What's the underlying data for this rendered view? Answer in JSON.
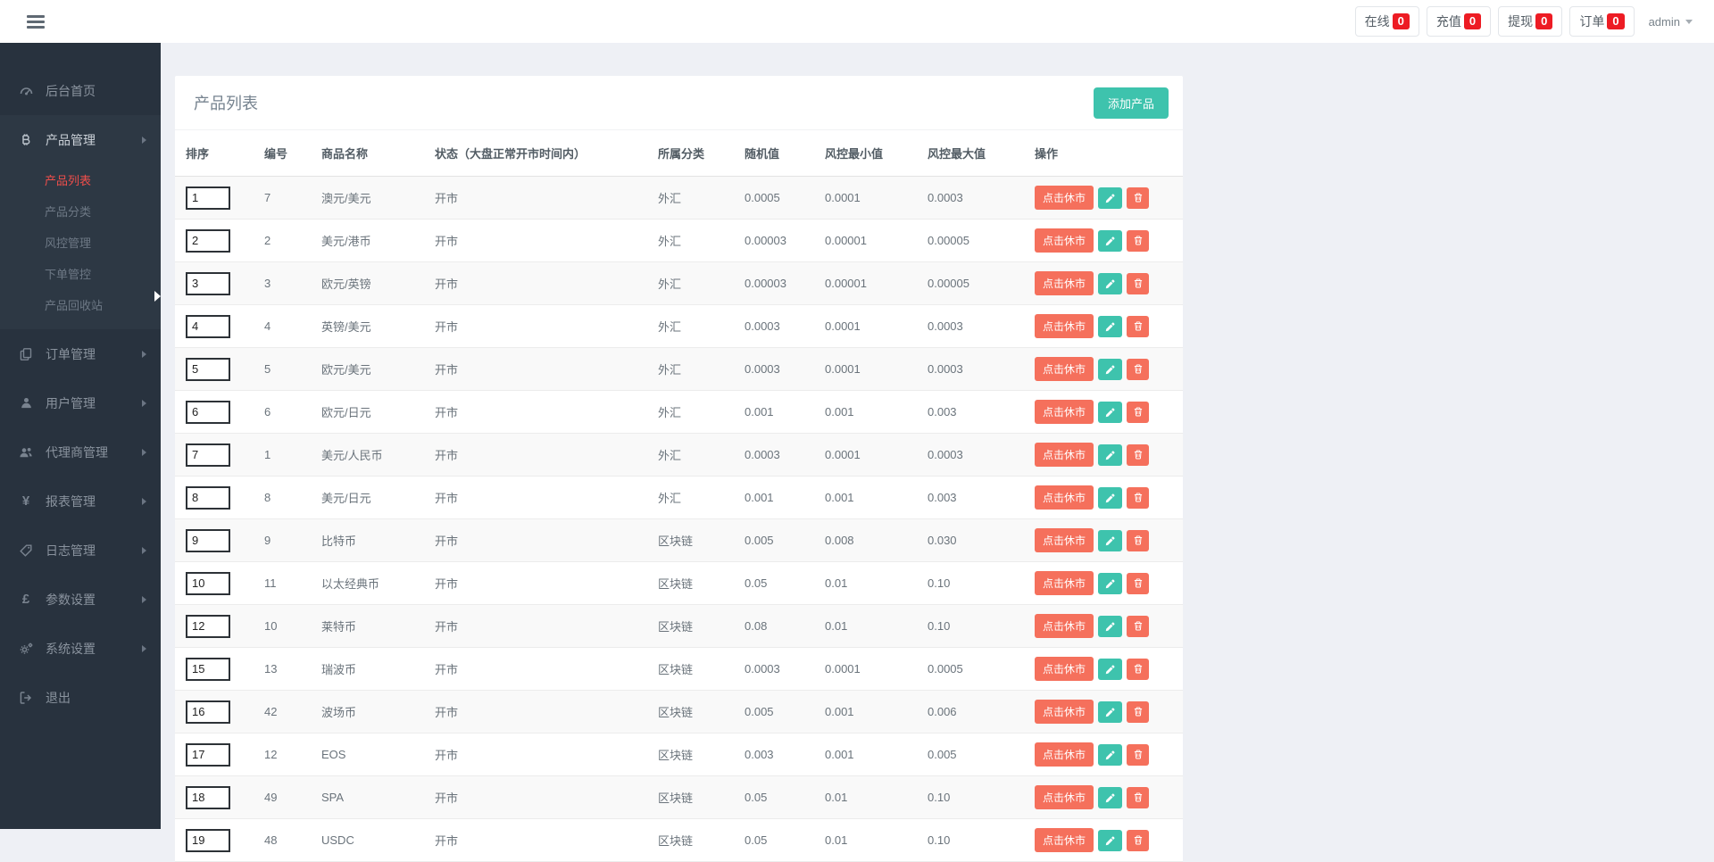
{
  "header": {
    "stats": [
      {
        "label": "在线",
        "count": "0"
      },
      {
        "label": "充值",
        "count": "0"
      },
      {
        "label": "提现",
        "count": "0"
      },
      {
        "label": "订单",
        "count": "0"
      }
    ],
    "user": "admin"
  },
  "sidebar": {
    "items": [
      {
        "label": "后台首页",
        "icon": "dashboard-icon"
      },
      {
        "label": "产品管理",
        "icon": "bitcoin-icon"
      },
      {
        "label": "订单管理",
        "icon": "orders-icon"
      },
      {
        "label": "用户管理",
        "icon": "user-icon"
      },
      {
        "label": "代理商管理",
        "icon": "agents-icon"
      },
      {
        "label": "报表管理",
        "icon": "yen-icon"
      },
      {
        "label": "日志管理",
        "icon": "logs-icon"
      },
      {
        "label": "参数设置",
        "icon": "pound-icon"
      },
      {
        "label": "系统设置",
        "icon": "gears-icon"
      },
      {
        "label": "退出",
        "icon": "logout-icon"
      }
    ],
    "product_submenu": [
      "产品列表",
      "产品分类",
      "风控管理",
      "下单管控",
      "产品回收站"
    ],
    "active_item": "产品管理",
    "active_submenu": "产品列表"
  },
  "panel": {
    "title": "产品列表",
    "add_button_label": "添加产品"
  },
  "table": {
    "headers": [
      "排序",
      "编号",
      "商品名称",
      "状态（大盘正常开市时间内）",
      "所属分类",
      "随机值",
      "风控最小值",
      "风控最大值",
      "操作"
    ],
    "close_market_label": "点击休市",
    "rows": [
      {
        "sort": "1",
        "id": "7",
        "name": "澳元/美元",
        "status": "开市",
        "category": "外汇",
        "random": "0.0005",
        "risk_min": "0.0001",
        "risk_max": "0.0003"
      },
      {
        "sort": "2",
        "id": "2",
        "name": "美元/港币",
        "status": "开市",
        "category": "外汇",
        "random": "0.00003",
        "risk_min": "0.00001",
        "risk_max": "0.00005"
      },
      {
        "sort": "3",
        "id": "3",
        "name": "欧元/英镑",
        "status": "开市",
        "category": "外汇",
        "random": "0.00003",
        "risk_min": "0.00001",
        "risk_max": "0.00005"
      },
      {
        "sort": "4",
        "id": "4",
        "name": "英镑/美元",
        "status": "开市",
        "category": "外汇",
        "random": "0.0003",
        "risk_min": "0.0001",
        "risk_max": "0.0003"
      },
      {
        "sort": "5",
        "id": "5",
        "name": "欧元/美元",
        "status": "开市",
        "category": "外汇",
        "random": "0.0003",
        "risk_min": "0.0001",
        "risk_max": "0.0003"
      },
      {
        "sort": "6",
        "id": "6",
        "name": "欧元/日元",
        "status": "开市",
        "category": "外汇",
        "random": "0.001",
        "risk_min": "0.001",
        "risk_max": "0.003"
      },
      {
        "sort": "7",
        "id": "1",
        "name": "美元/人民币",
        "status": "开市",
        "category": "外汇",
        "random": "0.0003",
        "risk_min": "0.0001",
        "risk_max": "0.0003"
      },
      {
        "sort": "8",
        "id": "8",
        "name": "美元/日元",
        "status": "开市",
        "category": "外汇",
        "random": "0.001",
        "risk_min": "0.001",
        "risk_max": "0.003"
      },
      {
        "sort": "9",
        "id": "9",
        "name": "比特币",
        "status": "开市",
        "category": "区块链",
        "random": "0.005",
        "risk_min": "0.008",
        "risk_max": "0.030"
      },
      {
        "sort": "10",
        "id": "11",
        "name": "以太经典币",
        "status": "开市",
        "category": "区块链",
        "random": "0.05",
        "risk_min": "0.01",
        "risk_max": "0.10"
      },
      {
        "sort": "12",
        "id": "10",
        "name": "莱特币",
        "status": "开市",
        "category": "区块链",
        "random": "0.08",
        "risk_min": "0.01",
        "risk_max": "0.10"
      },
      {
        "sort": "15",
        "id": "13",
        "name": "瑞波币",
        "status": "开市",
        "category": "区块链",
        "random": "0.0003",
        "risk_min": "0.0001",
        "risk_max": "0.0005"
      },
      {
        "sort": "16",
        "id": "42",
        "name": "波场币",
        "status": "开市",
        "category": "区块链",
        "random": "0.005",
        "risk_min": "0.001",
        "risk_max": "0.006"
      },
      {
        "sort": "17",
        "id": "12",
        "name": "EOS",
        "status": "开市",
        "category": "区块链",
        "random": "0.003",
        "risk_min": "0.001",
        "risk_max": "0.005"
      },
      {
        "sort": "18",
        "id": "49",
        "name": "SPA",
        "status": "开市",
        "category": "区块链",
        "random": "0.05",
        "risk_min": "0.01",
        "risk_max": "0.10"
      },
      {
        "sort": "19",
        "id": "48",
        "name": "USDC",
        "status": "开市",
        "category": "区块链",
        "random": "0.05",
        "risk_min": "0.01",
        "risk_max": "0.10"
      }
    ]
  },
  "colors": {
    "teal": "#3ec3ad",
    "salmon": "#f5705c",
    "badge_red": "#ed1c24",
    "sidebar_bg": "#28323e",
    "submenu_bg": "#2d3844",
    "active_link_red": "#ef4e4b",
    "page_bg": "#eef0f5"
  }
}
